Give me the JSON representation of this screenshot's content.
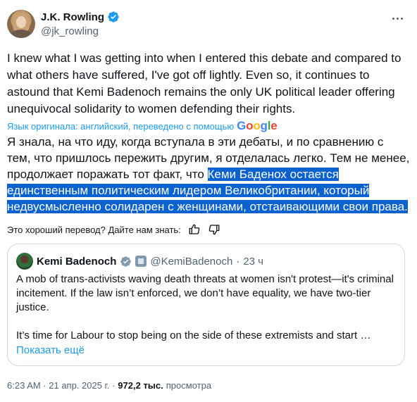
{
  "author": {
    "display_name": "J.K. Rowling",
    "handle": "@jk_rowling"
  },
  "tweet": {
    "text": "I knew what I was getting into when I entered this debate and compared to what others have suffered, I've got off lightly. Even so, it continues to astound that Kemi Badenoch remains the only UK political leader offering unequivocal solidarity to women defending their rights."
  },
  "translation": {
    "attribution": "Язык оригинала: английский, переведено с помощью",
    "provider": "Google",
    "text_plain": "Я знала, на что иду, когда вступала в эти дебаты, и по сравнению с тем, что пришлось пережить другим, я отделалась легко. Тем не менее, продолжает поражать тот факт, что",
    "text_highlighted": "Кеми Баденох остается единственным политическим лидером Великобритании, который недвусмысленно солидарен с женщинами, отстаивающими свои права."
  },
  "feedback": {
    "prompt": "Это хороший перевод? Дайте нам знать:",
    "thumbs_up_icon": "thumbs-up-icon",
    "thumbs_down_icon": "thumbs-down-icon"
  },
  "quoted_tweet": {
    "display_name": "Kemi Badenoch",
    "handle": "@KemiBadenoch",
    "separator": "·",
    "time": "23 ч",
    "paragraph_1": "A mob of trans-activists waving death threats at women isn't protest—it's criminal incitement. If the law isn’t enforced, we don’t have equality, we have two-tier justice.",
    "paragraph_2": "It’s time for Labour to stop being on the side of these extremists and start …",
    "show_more": "Показать ещё"
  },
  "meta": {
    "time": "6:23 AM · 21 апр. 2025 г. ·",
    "views_count": "972,2 тыс.",
    "views_label": "просмотра"
  },
  "colors": {
    "accent": "#1d9bf0",
    "highlight": "#0a61d0",
    "secondary_text": "#536471",
    "border": "#cfd9de"
  }
}
